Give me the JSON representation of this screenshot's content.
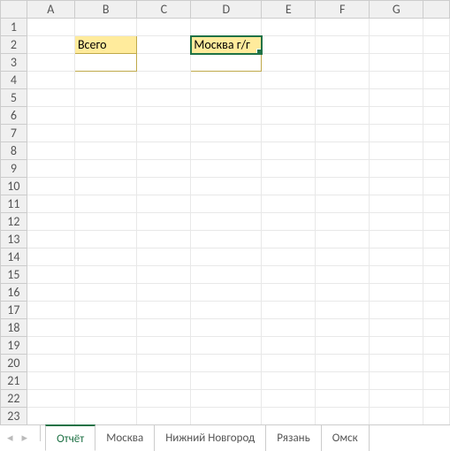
{
  "columns": [
    "A",
    "B",
    "C",
    "D",
    "E",
    "F",
    "G"
  ],
  "row_count": 23,
  "cells": {
    "B2": {
      "value": "Всего",
      "style": "yellow"
    },
    "D2": {
      "value": "Москва г/г",
      "style": "yellow active"
    },
    "B3": {
      "value": "",
      "style": "below-yellow-b"
    },
    "D3": {
      "value": "",
      "style": "below-yellow-d"
    }
  },
  "active_cell": "D2",
  "tabs": [
    {
      "label": "Отчёт",
      "active": true
    },
    {
      "label": "Москва",
      "active": false
    },
    {
      "label": "Нижний Новгород",
      "active": false
    },
    {
      "label": "Рязань",
      "active": false
    },
    {
      "label": "Омск",
      "active": false
    }
  ]
}
